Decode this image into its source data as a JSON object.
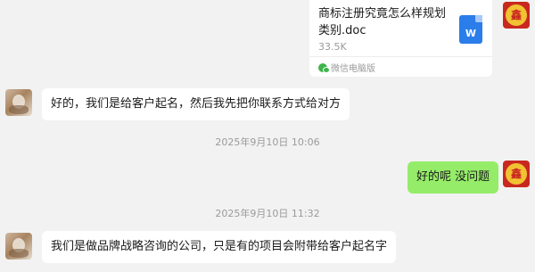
{
  "file_message": {
    "file_name": "商标注册究竟怎么样规划类别.doc",
    "file_size": "33.5K",
    "source": "微信电脑版",
    "icon_letter": "W",
    "icon_color": "#2b7de9"
  },
  "messages": [
    {
      "side": "left",
      "text": "好的，我们是给客户起名，然后我先把你联系方式给对方"
    },
    {
      "side": "right",
      "text": "好的呢  没问题"
    },
    {
      "side": "left",
      "text": "我们是做品牌战略咨询的公司，只是有的项目会附带给客户起名字"
    }
  ],
  "timestamps": [
    "2025年9月10日 10:06",
    "2025年9月10日 11:32"
  ],
  "colors": {
    "background": "#f2f2f2",
    "self_bubble": "#95ec69",
    "other_bubble": "#ffffff"
  },
  "right_avatar_glyph": "鑫"
}
